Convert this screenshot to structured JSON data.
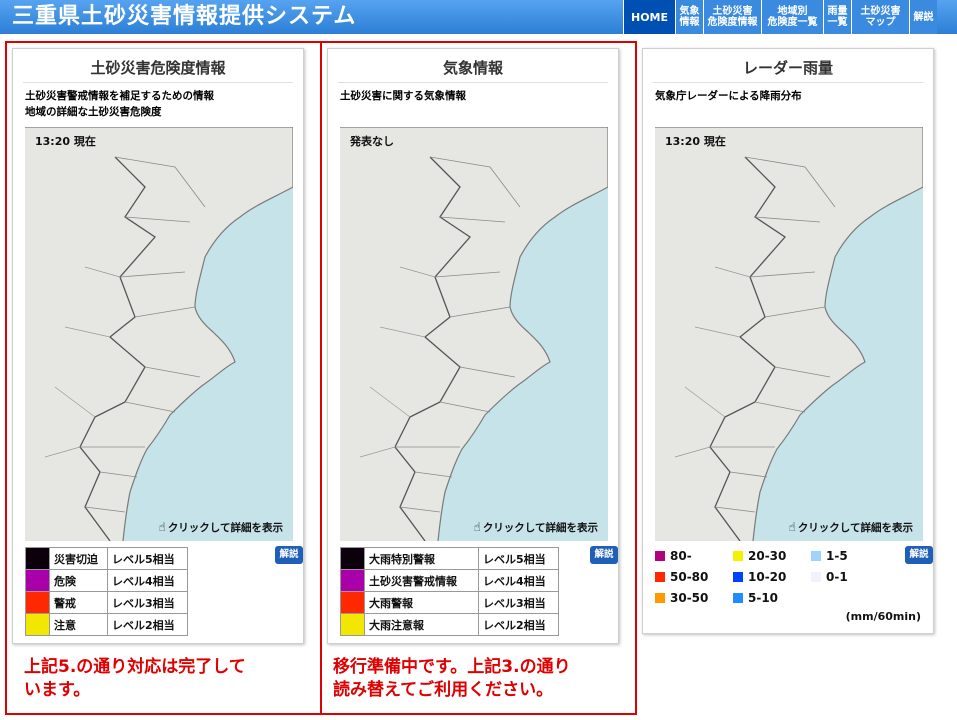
{
  "header": {
    "title": "三重県土砂災害情報提供システム",
    "nav": [
      {
        "label": "HOME",
        "active": true
      },
      {
        "label": "気象\n情報",
        "active": false
      },
      {
        "label": "土砂災害\n危険度情報",
        "active": false
      },
      {
        "label": "地域別\n危険度一覧",
        "active": false
      },
      {
        "label": "雨量\n一覧",
        "active": false
      },
      {
        "label": "土砂災害\nマップ",
        "active": false
      },
      {
        "label": "解説",
        "active": false
      }
    ]
  },
  "panels": {
    "risk": {
      "title": "土砂災害危険度情報",
      "desc1": "土砂災害警戒情報を補足するための情報",
      "desc2": "地域の詳細な土砂災害危険度",
      "stamp": "13:20 現在",
      "link": "クリックして詳細を表示",
      "help": "解説",
      "legend": [
        {
          "color": "#0c000c",
          "name": "災害切迫",
          "level": "レベル5相当"
        },
        {
          "color": "#aa00aa",
          "name": "危険",
          "level": "レベル4相当"
        },
        {
          "color": "#ff2800",
          "name": "警戒",
          "level": "レベル3相当"
        },
        {
          "color": "#f2e700",
          "name": "注意",
          "level": "レベル2相当"
        }
      ]
    },
    "weather": {
      "title": "気象情報",
      "desc1": "土砂災害に関する気象情報",
      "desc2": "",
      "stamp": "発表なし",
      "link": "クリックして詳細を表示",
      "help": "解説",
      "legend": [
        {
          "color": "#0c000c",
          "name": "大雨特別警報",
          "level": "レベル5相当"
        },
        {
          "color": "#aa00aa",
          "name": "土砂災害警戒情報",
          "level": "レベル4相当"
        },
        {
          "color": "#ff2800",
          "name": "大雨警報",
          "level": "レベル3相当"
        },
        {
          "color": "#f2e700",
          "name": "大雨注意報",
          "level": "レベル2相当"
        }
      ]
    },
    "radar": {
      "title": "レーダー雨量",
      "desc1": "気象庁レーダーによる降雨分布",
      "stamp": "13:20 現在",
      "link": "クリックして詳細を表示",
      "help": "解説",
      "legend": [
        {
          "color": "#b4007a",
          "label": "80-"
        },
        {
          "color": "#ff2800",
          "label": "50-80"
        },
        {
          "color": "#ff9900",
          "label": "30-50"
        },
        {
          "color": "#f2f200",
          "label": "20-30"
        },
        {
          "color": "#0041ff",
          "label": "10-20"
        },
        {
          "color": "#218cff",
          "label": "5-10"
        },
        {
          "color": "#a0d2ff",
          "label": "1-5"
        },
        {
          "color": "#f2f2ff",
          "label": "0-1"
        }
      ],
      "unit": "(mm/60min)"
    }
  },
  "notices": {
    "left": "上記5.の通り対応は完了して\nいます。",
    "right": "移行準備中です。上記3.の通り\n読み替えてご利用ください。"
  },
  "colors": {
    "header_blue": "#2c7fd6",
    "home_active": "#0050b4",
    "sea": "#c5e3e8",
    "land": "#e6e6e3",
    "notice_red": "#e00000"
  }
}
